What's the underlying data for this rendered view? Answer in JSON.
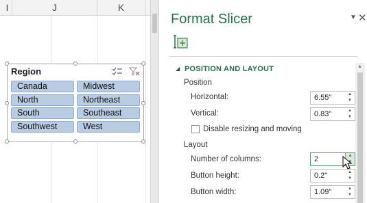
{
  "sheet": {
    "columns": [
      "I",
      "J",
      "K"
    ]
  },
  "slicer": {
    "title": "Region",
    "icons": [
      "multi-select-icon",
      "clear-filter-icon"
    ],
    "items": [
      "Canada",
      "Midwest",
      "North",
      "Northeast",
      "South",
      "Southeast",
      "Southwest",
      "West"
    ],
    "button_fill": "#b8cce4",
    "button_border": "#8faad3"
  },
  "pane": {
    "title": "Format Slicer",
    "menu_glyph": "▼",
    "close_glyph": "✕",
    "tab_icon": "size-properties-icon",
    "accent": "#217346",
    "section": {
      "arrow": "◢",
      "title": "POSITION AND LAYOUT"
    },
    "position_group": "Position",
    "horizontal": {
      "label": "Horizontal:",
      "value": "6.55\""
    },
    "vertical": {
      "label": "Vertical:",
      "value": "0.83\""
    },
    "disable_resizing": {
      "label": "Disable resizing and moving",
      "checked": false
    },
    "layout_group": "Layout",
    "num_columns": {
      "label": "Number of columns:",
      "value": "2"
    },
    "button_height": {
      "label": "Button height:",
      "value": "0.2\""
    },
    "button_width": {
      "label": "Button width:",
      "value": "1.09\""
    },
    "spin_up": "▲",
    "spin_down": "▼"
  }
}
